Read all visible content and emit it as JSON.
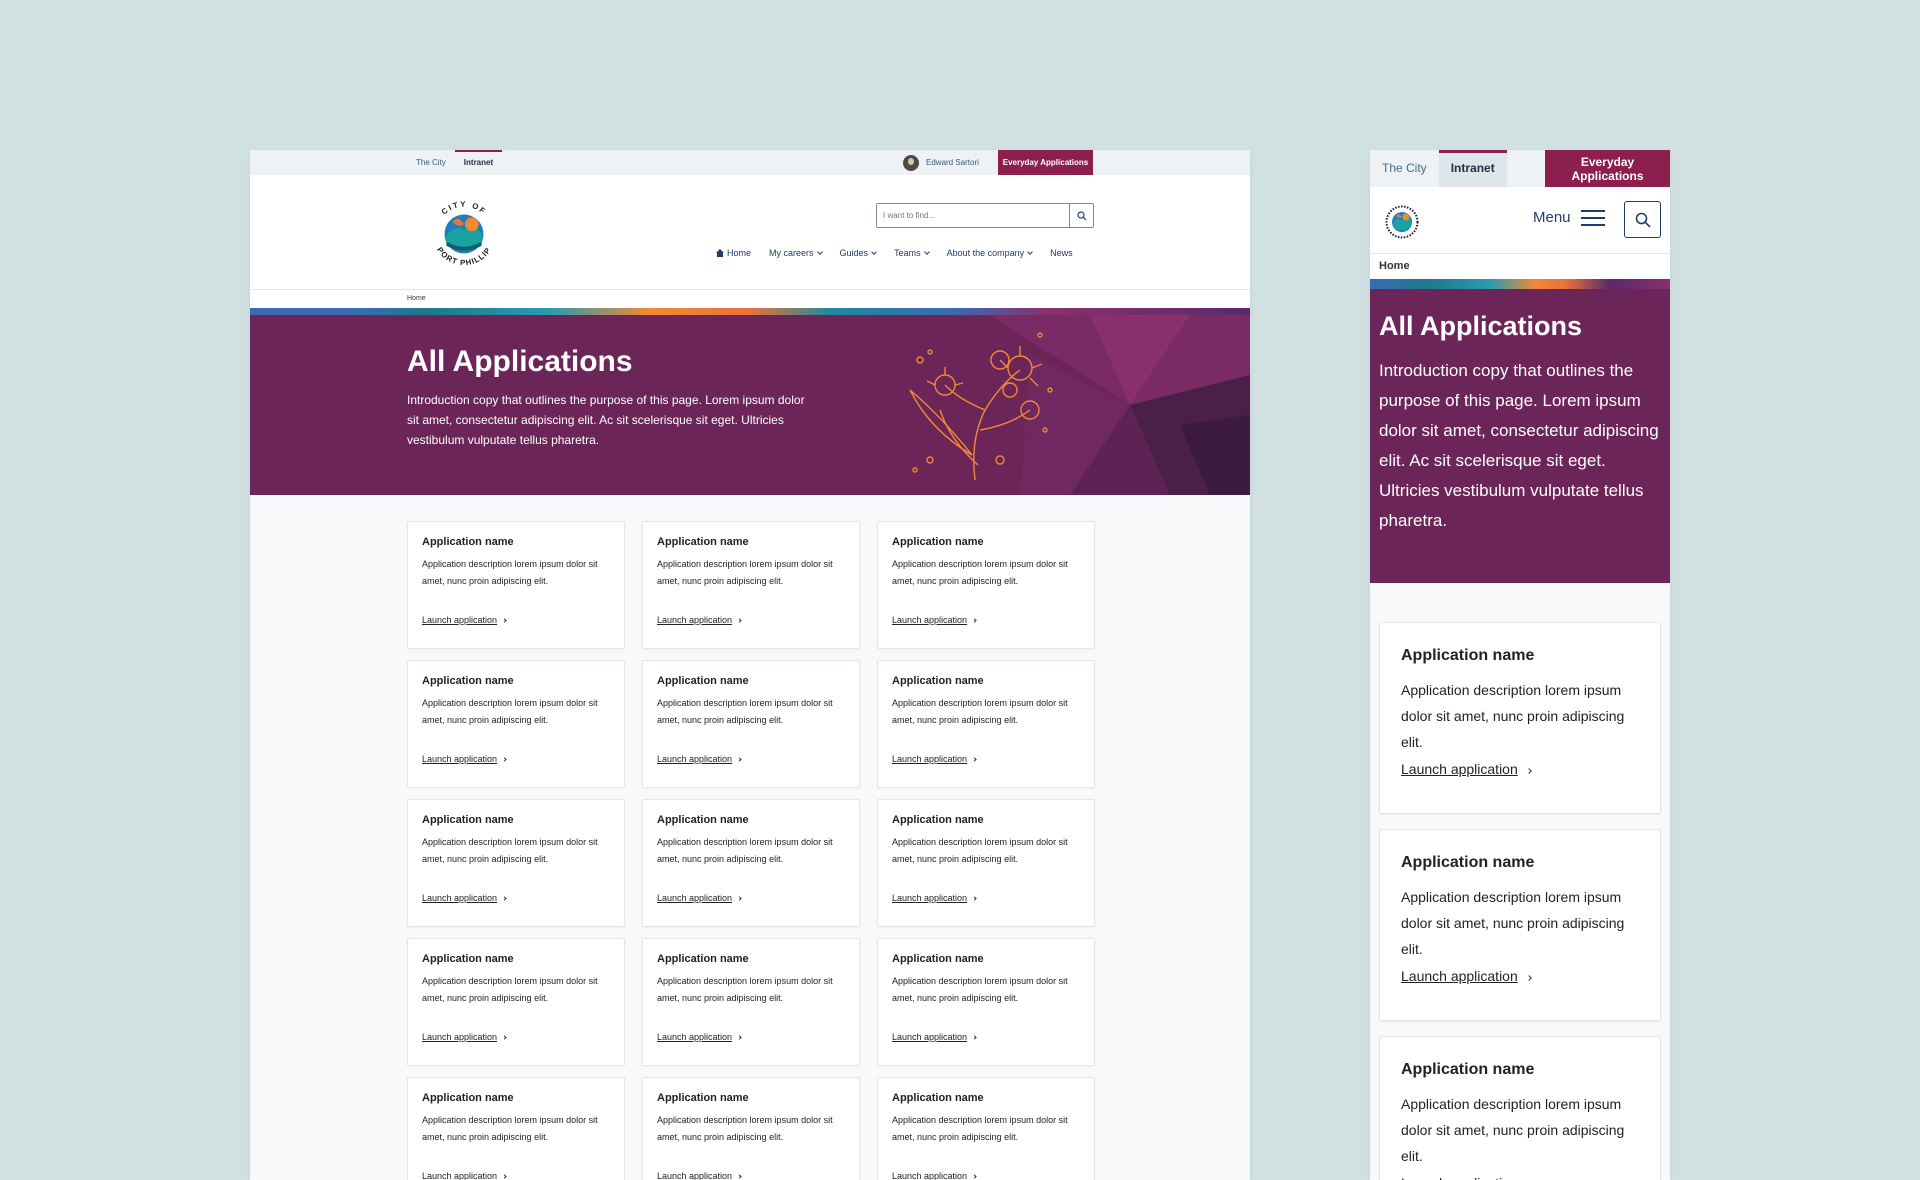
{
  "desktop": {
    "topbar": {
      "tabs": [
        {
          "label": "The City",
          "active": false
        },
        {
          "label": "Intranet",
          "active": true
        }
      ],
      "user_name": "Edward Sartori",
      "everyday_button": "Everyday Applications"
    },
    "header": {
      "logo_top_text": "CITY OF",
      "logo_bottom_text": "PORT PHILLIP",
      "search_placeholder": "I want to find...",
      "nav": [
        {
          "label": "Home",
          "icon": "home-icon",
          "dropdown": false
        },
        {
          "label": "My careers",
          "dropdown": true
        },
        {
          "label": "Guides",
          "dropdown": true
        },
        {
          "label": "Teams",
          "dropdown": true
        },
        {
          "label": "About the company",
          "dropdown": true
        },
        {
          "label": "News",
          "dropdown": false
        }
      ]
    },
    "breadcrumb": "Home",
    "hero": {
      "title": "All Applications",
      "intro": "Introduction copy that outlines the purpose of this page. Lorem ipsum dolor sit amet, consectetur adipiscing elit. Ac sit scelerisque sit eget. Ultricies vestibulum vulputate tellus pharetra."
    },
    "cards": [
      {
        "title": "Application name",
        "desc": "Application description lorem ipsum dolor sit amet, nunc proin adipiscing elit.",
        "link": "Launch application"
      },
      {
        "title": "Application name",
        "desc": "Application description lorem ipsum dolor sit amet, nunc proin adipiscing elit.",
        "link": "Launch application"
      },
      {
        "title": "Application name",
        "desc": "Application description lorem ipsum dolor sit amet, nunc proin adipiscing elit.",
        "link": "Launch application"
      },
      {
        "title": "Application name",
        "desc": "Application description lorem ipsum dolor sit amet, nunc proin adipiscing elit.",
        "link": "Launch application"
      },
      {
        "title": "Application name",
        "desc": "Application description lorem ipsum dolor sit amet, nunc proin adipiscing elit.",
        "link": "Launch application"
      },
      {
        "title": "Application name",
        "desc": "Application description lorem ipsum dolor sit amet, nunc proin adipiscing elit.",
        "link": "Launch application"
      },
      {
        "title": "Application name",
        "desc": "Application description lorem ipsum dolor sit amet, nunc proin adipiscing elit.",
        "link": "Launch application"
      },
      {
        "title": "Application name",
        "desc": "Application description lorem ipsum dolor sit amet, nunc proin adipiscing elit.",
        "link": "Launch application"
      },
      {
        "title": "Application name",
        "desc": "Application description lorem ipsum dolor sit amet, nunc proin adipiscing elit.",
        "link": "Launch application"
      },
      {
        "title": "Application name",
        "desc": "Application description lorem ipsum dolor sit amet, nunc proin adipiscing elit.",
        "link": "Launch application"
      },
      {
        "title": "Application name",
        "desc": "Application description lorem ipsum dolor sit amet, nunc proin adipiscing elit.",
        "link": "Launch application"
      },
      {
        "title": "Application name",
        "desc": "Application description lorem ipsum dolor sit amet, nunc proin adipiscing elit.",
        "link": "Launch application"
      },
      {
        "title": "Application name",
        "desc": "Application description lorem ipsum dolor sit amet, nunc proin adipiscing elit.",
        "link": "Launch application"
      },
      {
        "title": "Application name",
        "desc": "Application description lorem ipsum dolor sit amet, nunc proin adipiscing elit.",
        "link": "Launch application"
      },
      {
        "title": "Application name",
        "desc": "Application description lorem ipsum dolor sit amet, nunc proin adipiscing elit.",
        "link": "Launch application"
      }
    ]
  },
  "mobile": {
    "tabs": [
      {
        "label": "The City",
        "active": false
      },
      {
        "label": "Intranet",
        "active": true
      }
    ],
    "everyday_line1": "Everyday",
    "everyday_line2": "Applications",
    "menu_label": "Menu",
    "breadcrumb": "Home",
    "hero": {
      "title": "All Applications",
      "intro": "Introduction copy that outlines the purpose of this page. Lorem ipsum dolor sit amet, consectetur adipiscing elit. Ac sit scelerisque sit eget. Ultricies vestibulum vulputate tellus pharetra."
    },
    "cards": [
      {
        "title": "Application name",
        "desc": "Application description lorem ipsum dolor sit amet, nunc proin adipiscing elit.",
        "link": "Launch application"
      },
      {
        "title": "Application name",
        "desc": "Application description lorem ipsum dolor sit amet, nunc proin adipiscing elit.",
        "link": "Launch application"
      },
      {
        "title": "Application name",
        "desc": "Application description lorem ipsum dolor sit amet, nunc proin adipiscing elit.",
        "link": "Launch application"
      }
    ]
  },
  "colors": {
    "background": "#d1e1e1",
    "brand_plum": "#6b2558",
    "accent_magenta": "#8d1f4f",
    "nav_blue": "#1f3d6a",
    "card_bg": "#ffffff"
  }
}
